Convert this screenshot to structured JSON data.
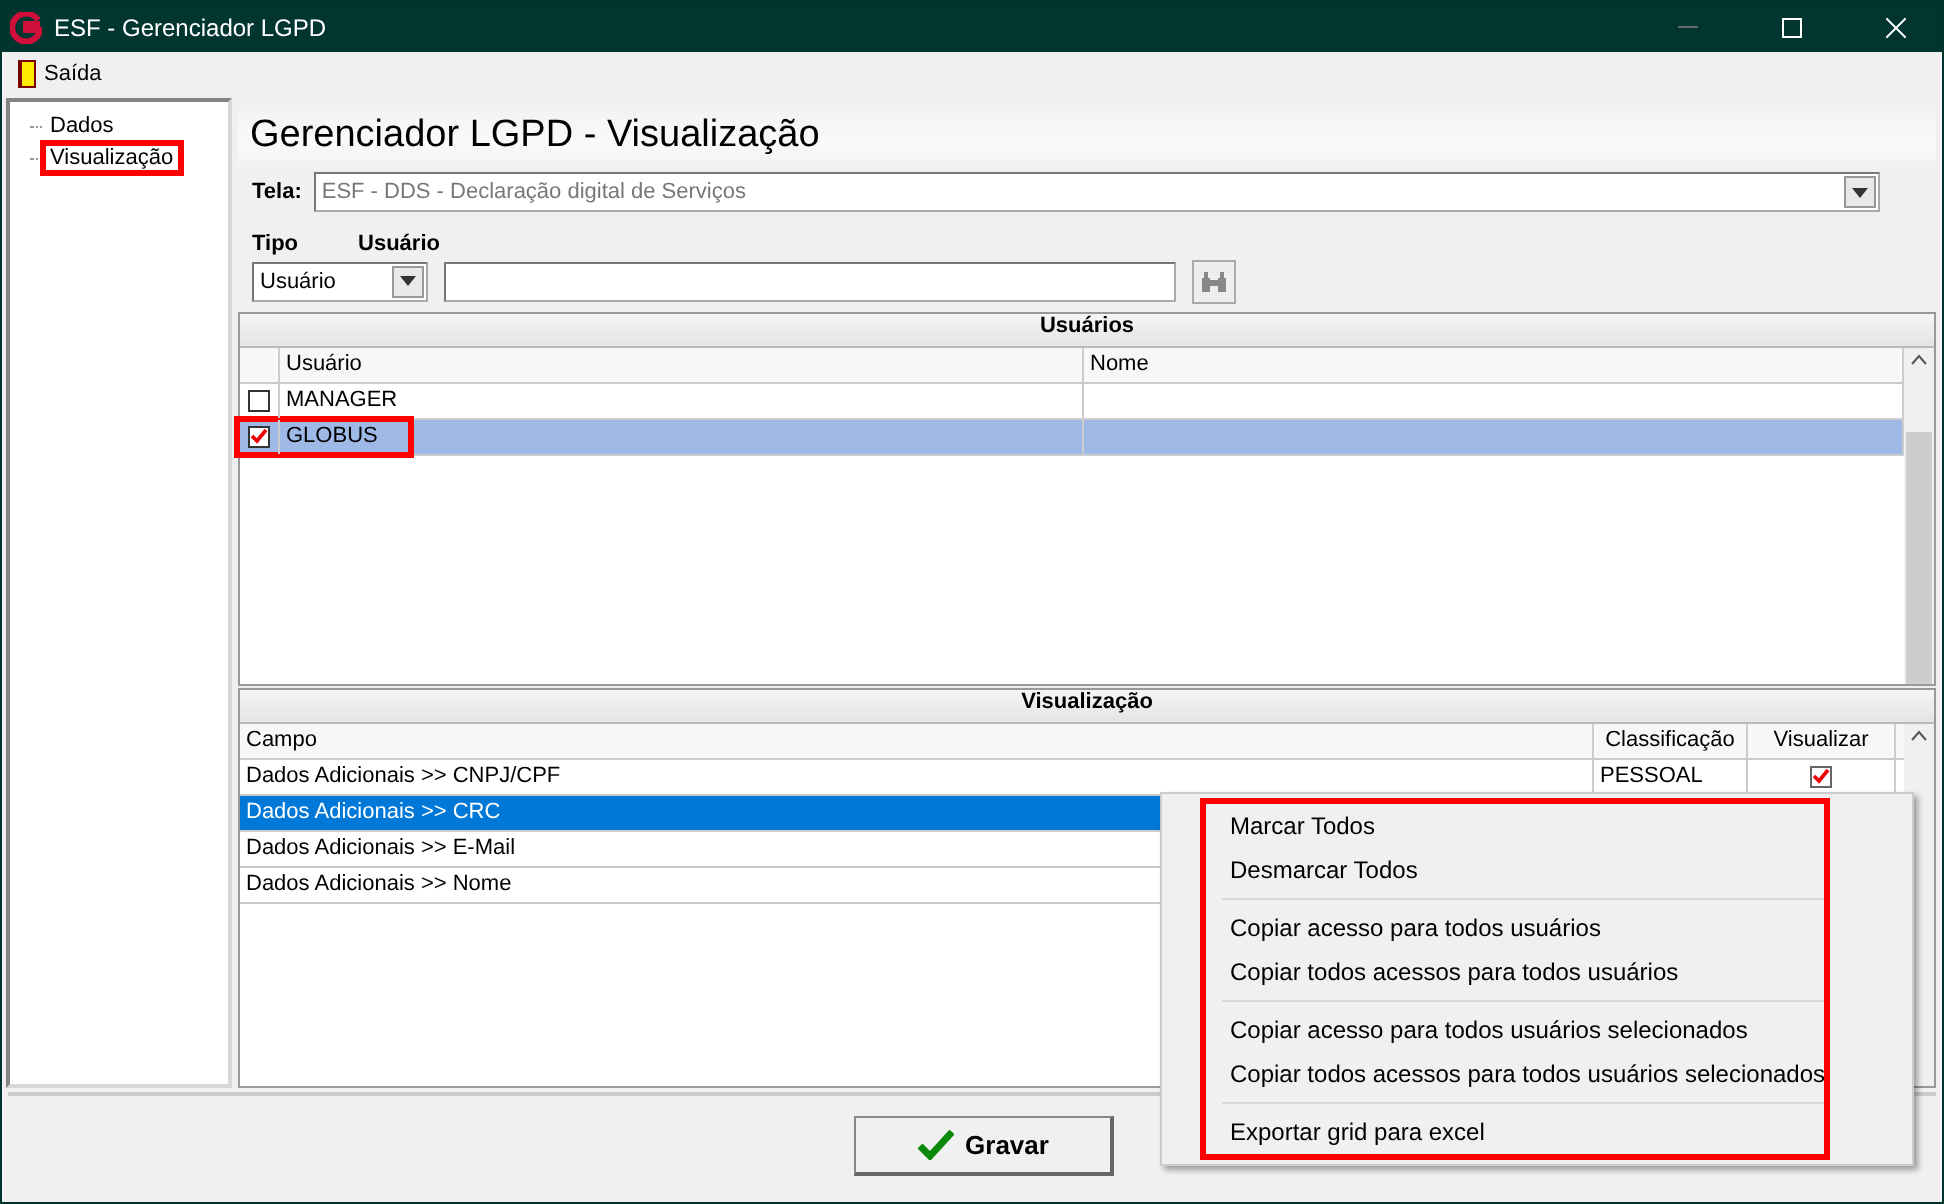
{
  "window": {
    "title": "ESF - Gerenciador LGPD"
  },
  "menu": [
    {
      "label": "Saída"
    }
  ],
  "tree": [
    {
      "label": "Dados",
      "highlighted": false
    },
    {
      "label": "Visualização",
      "highlighted": true
    }
  ],
  "heading": "Gerenciador LGPD - Visualização",
  "tela": {
    "label": "Tela:",
    "value": "ESF - DDS - Declaração digital de Serviços",
    "disabled": true
  },
  "tipo": {
    "label": "Tipo",
    "value": "Usuário"
  },
  "usuario": {
    "label": "Usuário"
  },
  "users_grid": {
    "title": "Usuários",
    "columns": [
      "Usuário",
      "Nome"
    ],
    "rows": [
      {
        "usuario": "MANAGER",
        "checked": false,
        "selected": false,
        "highlighted": false
      },
      {
        "usuario": "GLOBUS",
        "checked": true,
        "selected": true,
        "highlighted": true
      }
    ]
  },
  "fields_grid": {
    "title": "Visualização",
    "columns": [
      "Campo",
      "Classificação",
      "Visualizar"
    ],
    "rows": [
      {
        "campo": "Dados Adicionais >> CNPJ/CPF",
        "classificacao": "PESSOAL",
        "visualizar": true,
        "selected": false
      },
      {
        "campo": "Dados Adicionais >> CRC",
        "selected": true
      },
      {
        "campo": "Dados Adicionais >> E-Mail",
        "selected": false
      },
      {
        "campo": "Dados Adicionais >> Nome",
        "selected": false
      }
    ]
  },
  "context_menu": {
    "highlighted": true,
    "groups": [
      [
        "Marcar Todos",
        "Desmarcar Todos"
      ],
      [
        "Copiar acesso para todos usuários",
        "Copiar todos acessos para todos usuários"
      ],
      [
        "Copiar acesso para todos usuários selecionados",
        "Copiar todos acessos para todos usuários selecionados"
      ],
      [
        "Exportar grid para excel"
      ]
    ]
  },
  "save_button": {
    "label": "Gravar"
  }
}
